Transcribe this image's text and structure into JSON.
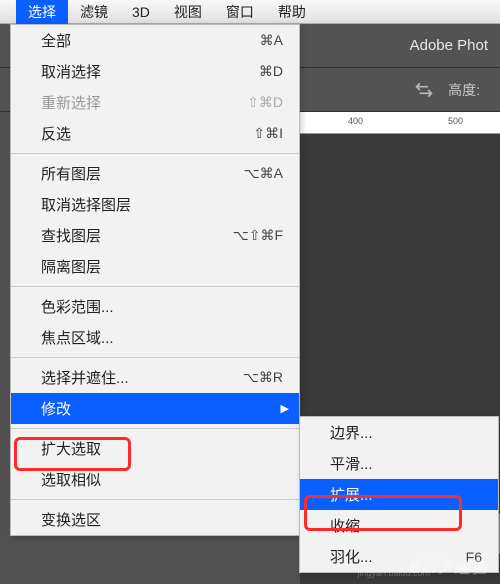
{
  "menubar": {
    "items": [
      "选择",
      "滤镜",
      "3D",
      "视图",
      "窗口",
      "帮助"
    ],
    "active_index": 0
  },
  "app": {
    "title": "Adobe Phot",
    "toolbar_label": "高度:"
  },
  "ruler": {
    "marks": [
      {
        "pos": 48,
        "label": "400"
      },
      {
        "pos": 148,
        "label": "500"
      }
    ]
  },
  "menu": {
    "groups": [
      [
        {
          "label": "全部",
          "shortcut": "⌘A",
          "enabled": true
        },
        {
          "label": "取消选择",
          "shortcut": "⌘D",
          "enabled": true
        },
        {
          "label": "重新选择",
          "shortcut": "⇧⌘D",
          "enabled": false
        },
        {
          "label": "反选",
          "shortcut": "⇧⌘I",
          "enabled": true
        }
      ],
      [
        {
          "label": "所有图层",
          "shortcut": "⌥⌘A",
          "enabled": true
        },
        {
          "label": "取消选择图层",
          "shortcut": "",
          "enabled": true
        },
        {
          "label": "查找图层",
          "shortcut": "⌥⇧⌘F",
          "enabled": true
        },
        {
          "label": "隔离图层",
          "shortcut": "",
          "enabled": true
        }
      ],
      [
        {
          "label": "色彩范围...",
          "shortcut": "",
          "enabled": true
        },
        {
          "label": "焦点区域...",
          "shortcut": "",
          "enabled": true
        }
      ],
      [
        {
          "label": "选择并遮住...",
          "shortcut": "⌥⌘R",
          "enabled": true
        },
        {
          "label": "修改",
          "shortcut": "",
          "enabled": true,
          "submenu": true,
          "highlighted": true
        }
      ],
      [
        {
          "label": "扩大选取",
          "shortcut": "",
          "enabled": true
        },
        {
          "label": "选取相似",
          "shortcut": "",
          "enabled": true
        }
      ],
      [
        {
          "label": "变换选区",
          "shortcut": "",
          "enabled": true
        }
      ]
    ]
  },
  "submenu": {
    "items": [
      {
        "label": "边界...",
        "highlighted": false
      },
      {
        "label": "平滑...",
        "highlighted": false
      },
      {
        "label": "扩展...",
        "highlighted": true
      },
      {
        "label": "收缩...",
        "highlighted": false
      },
      {
        "label": "羽化...",
        "shortcut": "F6",
        "highlighted": false
      }
    ]
  },
  "watermark": {
    "main": "Bai㐅经验",
    "sub1": "百度经验",
    "sub2": "jingyan.baidu.com"
  }
}
